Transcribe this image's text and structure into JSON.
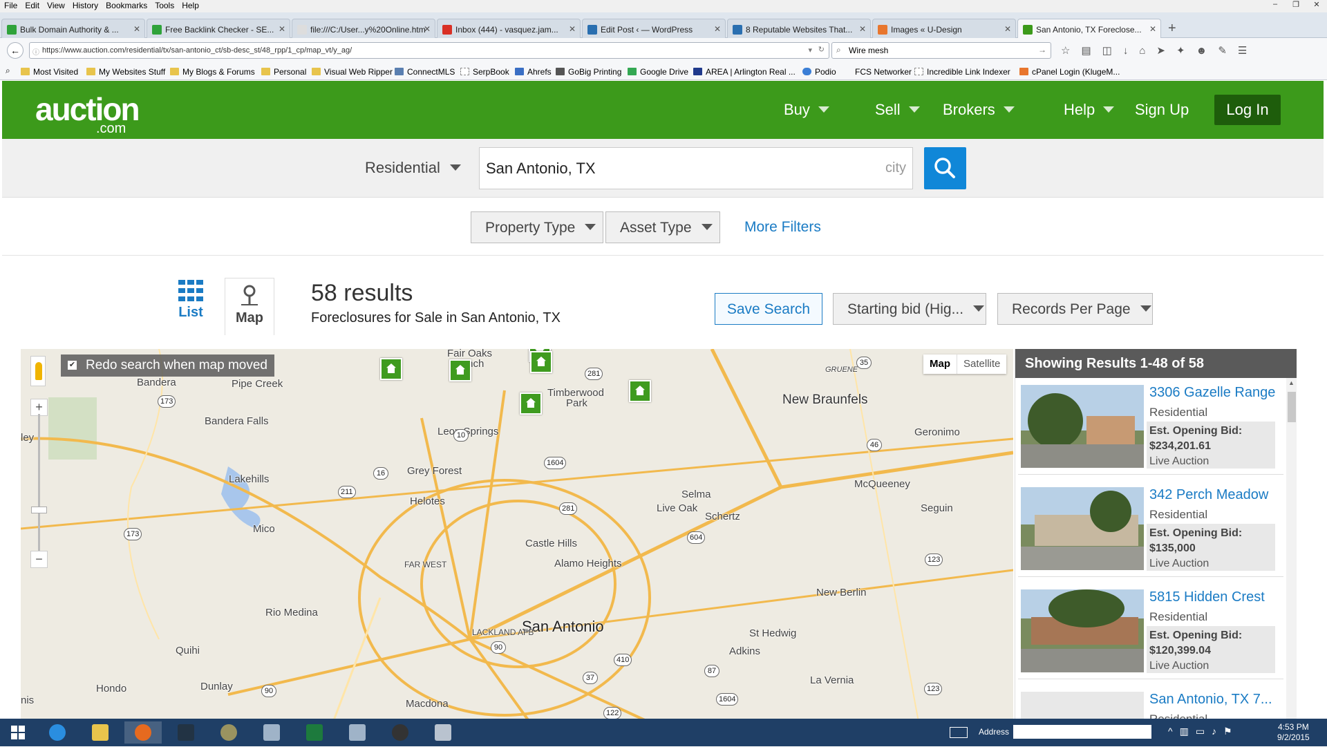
{
  "browser": {
    "menu": [
      "File",
      "Edit",
      "View",
      "History",
      "Bookmarks",
      "Tools",
      "Help"
    ],
    "tabs": [
      {
        "label": "Bulk Domain Authority & ...",
        "icon_color": "#2fa33a"
      },
      {
        "label": "Free Backlink Checker - SE...",
        "icon_color": "#2fa33a"
      },
      {
        "label": "file:///C:/User...y%20Online.htm",
        "icon_color": "#cccccc"
      },
      {
        "label": "Inbox (444) - vasquez.jam...",
        "icon_color": "#d93025"
      },
      {
        "label": "Edit Post ‹ — WordPress",
        "icon_color": "#2a6fb0"
      },
      {
        "label": "8 Reputable Websites That...",
        "icon_color": "#2a6fb0"
      },
      {
        "label": "Images « U-Design",
        "icon_color": "#e8762d"
      },
      {
        "label": "San Antonio, TX Foreclose...",
        "icon_color": "#3c9a1b"
      }
    ],
    "url": "https://www.auction.com/residential/tx/san-antonio_ct/sb-desc_st/48_rpp/1_cp/map_vt/y_ag/",
    "search_value": "Wire mesh",
    "bookmarks": [
      "Most Visited",
      "My Websites Stuff",
      "My Blogs & Forums",
      "Personal",
      "Visual Web Ripper",
      "ConnectMLS",
      "SerpBook",
      "Ahrefs",
      "GoBig Printing",
      "Google Drive",
      "AREA | Arlington Real ...",
      "Podio",
      "FCS Networker",
      "Incredible Link Indexer",
      "cPanel Login (KlugeM..."
    ]
  },
  "site": {
    "logo_main": "auction",
    "logo_sub": ".com",
    "nav": [
      "Buy",
      "Sell",
      "Brokers",
      "Help",
      "Sign Up"
    ],
    "login": "Log In",
    "brand_color": "#3c9a1b"
  },
  "search": {
    "category": "Residential",
    "location_value": "San Antonio, TX",
    "location_hint": "city"
  },
  "filters": {
    "property_type": "Property Type",
    "asset_type": "Asset Type",
    "more": "More Filters"
  },
  "results": {
    "list_label": "List",
    "map_label": "Map",
    "count": "58 results",
    "subtitle": "Foreclosures for Sale in San Antonio, TX",
    "save_search": "Save Search",
    "sort": "Starting bid (Hig...",
    "per_page": "Records Per Page"
  },
  "map": {
    "redo_label": "Redo search when map moved",
    "type_map": "Map",
    "type_satellite": "Satellite",
    "zoom_in": "+",
    "zoom_out": "−",
    "labels": {
      "fair_oaks": "Fair Oaks",
      "ranch": "Ranch",
      "bandera": "Bandera",
      "pipe_creek": "Pipe Creek",
      "bandera_falls": "Bandera Falls",
      "lakehills": "Lakehills",
      "mico": "Mico",
      "timberwood": "Timberwood",
      "park": "Park",
      "leon_springs": "Leon Springs",
      "grey_forest": "Grey Forest",
      "helotes": "Helotes",
      "new_braunfels": "New Braunfels",
      "gruene": "GRUENE",
      "geronimo": "Geronimo",
      "mcqueeney": "McQueeney",
      "selma": "Selma",
      "live_oak": "Live Oak",
      "schertz": "Schertz",
      "seguin": "Seguin",
      "castle_hills": "Castle Hills",
      "alamo_heights": "Alamo Heights",
      "far_west": "FAR WEST",
      "san_antonio": "San Antonio",
      "lackland": "LACKLAND AFB",
      "rio_medina": "Rio Medina",
      "quihi": "Quihi",
      "dunlay": "Dunlay",
      "hondo": "Hondo",
      "macdona": "Macdona",
      "new_berlin": "New Berlin",
      "st_hedwig": "St Hedwig",
      "adkins": "Adkins",
      "la_vernia": "La Vernia",
      "ley": "ley",
      "nis": "nis"
    },
    "shields": [
      "173",
      "16",
      "211",
      "173",
      "281",
      "35",
      "10",
      "1604",
      "281",
      "46",
      "604",
      "123",
      "90",
      "37",
      "410",
      "87",
      "1604",
      "123",
      "122",
      "90",
      "410"
    ]
  },
  "panel": {
    "header": "Showing Results 1-48 of 58",
    "listings": [
      {
        "title": "3306 Gazelle Range",
        "type": "Residential",
        "bid_label": "Est. Opening Bid:",
        "bid": "$234,201.61",
        "auction": "Live Auction"
      },
      {
        "title": "342 Perch Meadow",
        "type": "Residential",
        "bid_label": "Est. Opening Bid:",
        "bid": "$135,000",
        "auction": "Live Auction"
      },
      {
        "title": "5815 Hidden Crest",
        "type": "Residential",
        "bid_label": "Est. Opening Bid:",
        "bid": "$120,399.04",
        "auction": "Live Auction"
      },
      {
        "title": "San Antonio, TX 7...",
        "type": "Residential",
        "bid_label": "",
        "bid": "",
        "auction": ""
      }
    ]
  },
  "taskbar": {
    "address_label": "Address",
    "time": "4:53 PM",
    "date": "9/2/2015"
  }
}
